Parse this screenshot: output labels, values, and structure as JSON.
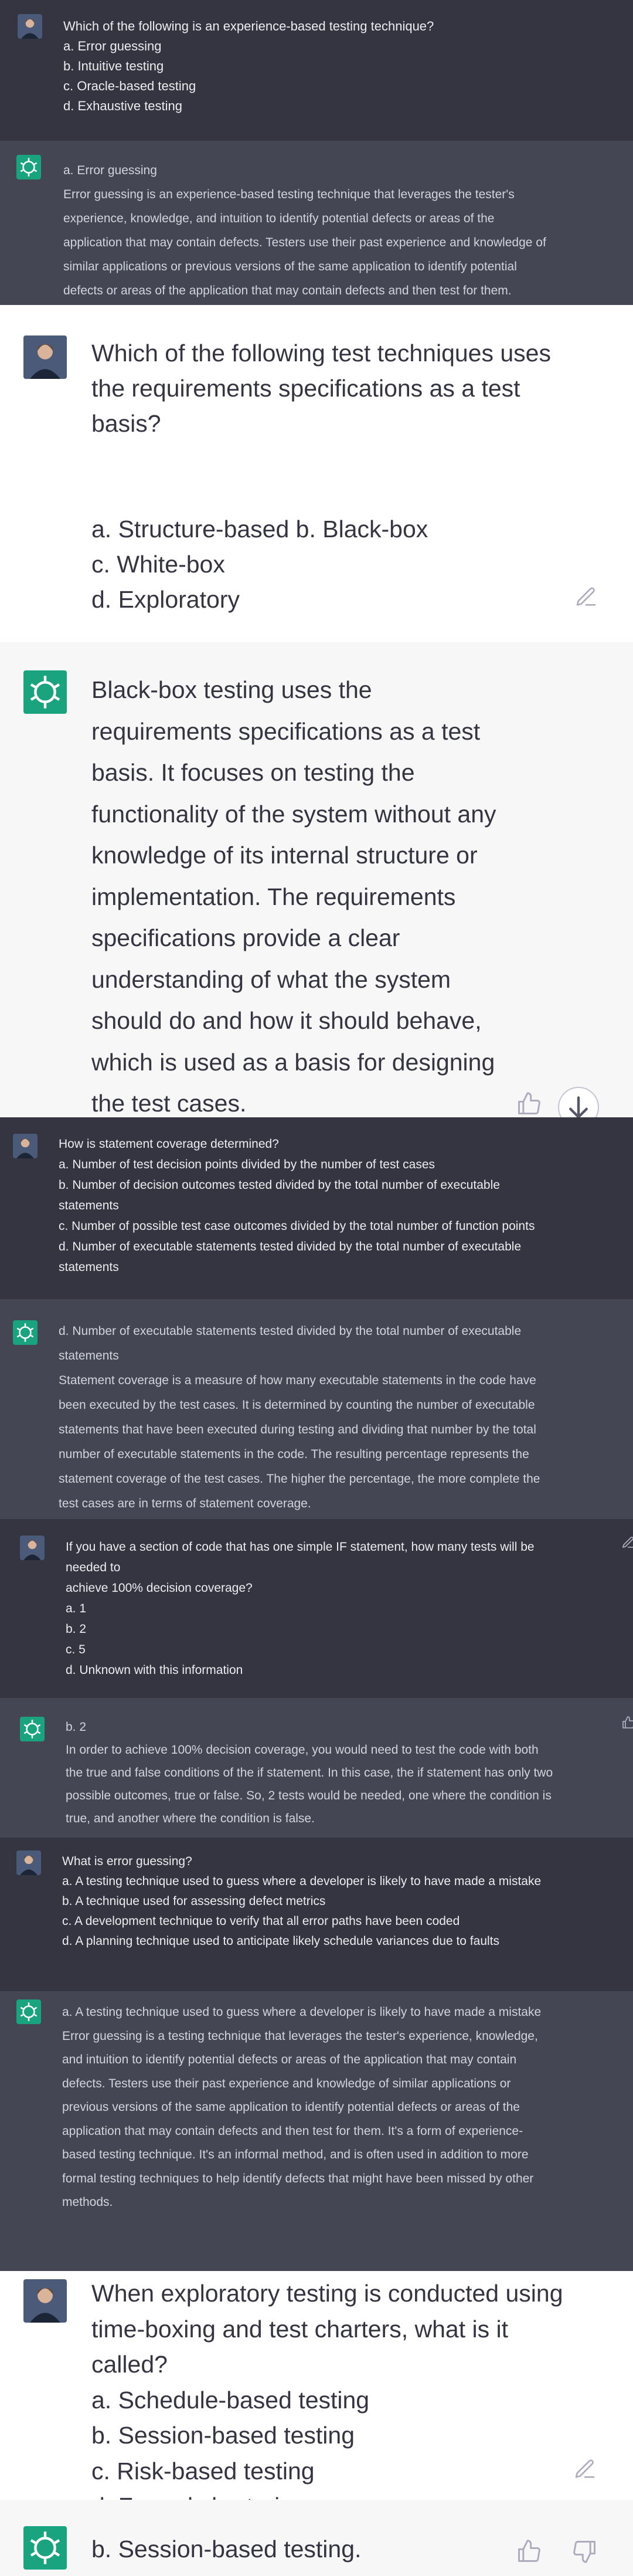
{
  "messages": [
    {
      "id": "q1",
      "lines": [
        "Which of the following is an experience-based testing technique?",
        "a. Error guessing",
        "b. Intuitive testing",
        "c. Oracle-based testing",
        "d. Exhaustive testing"
      ]
    },
    {
      "id": "a1",
      "lines": [
        "a. Error guessing",
        "Error guessing is an experience-based testing technique that leverages the tester's",
        "experience, knowledge, and intuition to identify potential defects or areas of the",
        "application that may contain defects. Testers use their past experience and knowledge of",
        "similar applications or previous versions of the same application to identify potential",
        "defects or areas of the application that may contain defects and then test for them."
      ]
    },
    {
      "id": "q2",
      "question_lines": [
        "Which of the following test techniques uses",
        "the requirements specifications as a test",
        "basis?"
      ],
      "option_lines": [
        "a. Structure-based b. Black-box",
        "c. White-box",
        "d. Exploratory"
      ]
    },
    {
      "id": "a2",
      "lines": [
        "Black-box testing uses the",
        "requirements specifications as a test",
        "basis. It focuses on testing the",
        "functionality of the system without any",
        "knowledge of its internal structure or",
        "implementation. The requirements",
        "specifications provide a clear",
        "understanding of what the system",
        "should do and how it should behave,",
        "which is used as a basis for designing",
        "the test cases."
      ]
    },
    {
      "id": "q3",
      "lines": [
        "How is statement coverage determined?",
        "a. Number of test decision points divided by the number of test cases",
        "b. Number of decision outcomes tested divided by the total number of executable",
        "statements",
        "c. Number of possible test case outcomes divided by the total number of function points",
        "d. Number of executable statements tested divided by the total number of executable",
        "statements"
      ]
    },
    {
      "id": "a3",
      "lines": [
        "d. Number of executable statements tested divided by the total number of executable",
        "statements",
        "Statement coverage is a measure of how many executable statements in the code have",
        "been executed by the test cases. It is determined by counting the number of executable",
        "statements that have been executed during testing and dividing that number by the total",
        "number of executable statements in the code. The resulting percentage represents the",
        "statement coverage of the test cases. The higher the percentage, the more complete the",
        "test cases are in terms of statement coverage."
      ]
    },
    {
      "id": "q4",
      "lines": [
        "If you have a section of code that has one simple IF statement, how many tests will be",
        "needed to",
        "achieve 100% decision coverage?",
        "a. 1",
        "b. 2",
        "c. 5",
        "d. Unknown with this information"
      ]
    },
    {
      "id": "a4",
      "lines": [
        "b. 2",
        "In order to achieve 100% decision coverage, you would need to test the code with both",
        "the true and false conditions of the if statement. In this case, the if statement has only two",
        "possible outcomes, true or false. So, 2 tests would be needed, one where the condition is",
        "true, and another where the condition is false."
      ]
    },
    {
      "id": "q5",
      "lines": [
        "What is error guessing?",
        "a. A testing technique used to guess where a developer is likely to have made a mistake",
        "b. A technique used for assessing defect metrics",
        "c. A development technique to verify that all error paths have been coded",
        "d. A planning technique used to anticipate likely schedule variances due to faults"
      ]
    },
    {
      "id": "a5",
      "lines": [
        "a. A testing technique used to guess where a developer is likely to have made a mistake",
        "Error guessing is a testing technique that leverages the tester's experience, knowledge,",
        "and intuition to identify potential defects or areas of the application that may contain",
        "defects. Testers use their past experience and knowledge of similar applications or",
        "previous versions of the same application to identify potential defects or areas of the",
        "application that may contain defects and then test for them. It's a form of experience-",
        "based testing technique. It's an informal method, and is often used in addition to more",
        "formal testing techniques to help identify defects that might have been missed by other",
        "methods."
      ]
    },
    {
      "id": "q6",
      "lines": [
        "When exploratory testing is conducted using",
        "time-boxing and test charters, what is it",
        "called?",
        "a. Schedule-based testing",
        "b. Session-based testing",
        "c. Risk-based testing",
        "d. Formal chartering"
      ]
    },
    {
      "id": "a6",
      "lines": [
        "b. Session-based testing."
      ]
    }
  ],
  "colors": {
    "dark_user_bg": "#343541",
    "dark_bot_bg": "#444654",
    "light_user_bg": "#ffffff",
    "light_bot_bg": "#f7f7f8",
    "openai_green": "#19a37f"
  },
  "icons": {
    "user_avatar": "user-avatar",
    "bot_avatar": "openai-logo-icon",
    "edit": "edit-icon",
    "thumbs_up": "thumbs-up-icon",
    "thumbs_down": "thumbs-down-icon",
    "scroll_down": "scroll-down-icon"
  }
}
